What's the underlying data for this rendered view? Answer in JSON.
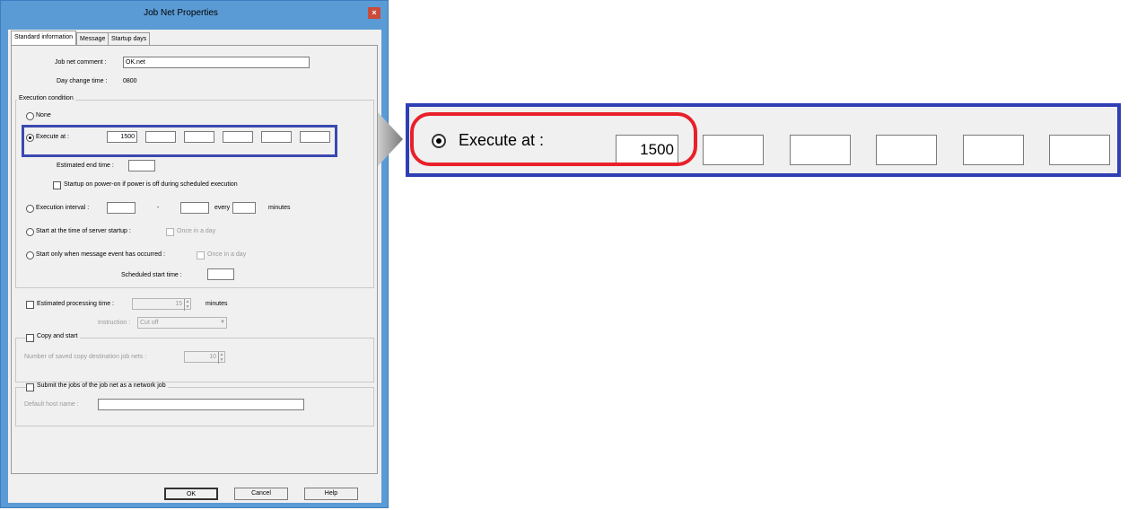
{
  "dialog": {
    "title": "Job Net Properties",
    "close_glyph": "×",
    "tabs": [
      {
        "label": "Standard information",
        "active": true
      },
      {
        "label": "Message",
        "active": false
      },
      {
        "label": "Startup days",
        "active": false
      }
    ],
    "jobnet_comment": {
      "label": "Job net comment :",
      "value": "OK.net"
    },
    "day_change": {
      "label": "Day change time :",
      "value": "0800"
    },
    "execution_group_label": "Execution condition",
    "none_label": "None",
    "execute_at": {
      "label": "Execute at :",
      "values": [
        "1500",
        "",
        "",
        "",
        "",
        ""
      ],
      "selected": true
    },
    "estimated_end": {
      "label": "Estimated end time :",
      "value": ""
    },
    "startup_power_label": "Startup on power-on if power is off during scheduled execution",
    "exec_interval": {
      "label": "Execution interval :",
      "dash": "-",
      "every_label": "every",
      "minutes_label": "minutes"
    },
    "start_server": {
      "label": "Start at the time of server startup :",
      "once_label": "Once in a day"
    },
    "start_message": {
      "label": "Start only when message event has occurred :",
      "once_label": "Once in a day",
      "sched_label": "Scheduled start time :"
    },
    "est_processing": {
      "label": "Estimated processing time :",
      "value": "15",
      "unit": "minutes",
      "instruction_label": "Instruction :",
      "instruction_value": "Cut off"
    },
    "copy_start": {
      "label": "Copy and start",
      "number_label": "Number of saved copy destination job nets :",
      "value": "10"
    },
    "network_job": {
      "label": "Submit the jobs of the job net as a network job",
      "host_label": "Default host name :"
    },
    "buttons": {
      "ok": "OK",
      "cancel": "Cancel",
      "help": "Help"
    }
  },
  "zoom": {
    "label": "Execute at :",
    "values": [
      "1500",
      "",
      "",
      "",
      "",
      ""
    ]
  },
  "colors": {
    "highlight_blue": "#3a49b0",
    "highlight_red": "#e8202a",
    "titlebar": "#5b9bd5"
  }
}
